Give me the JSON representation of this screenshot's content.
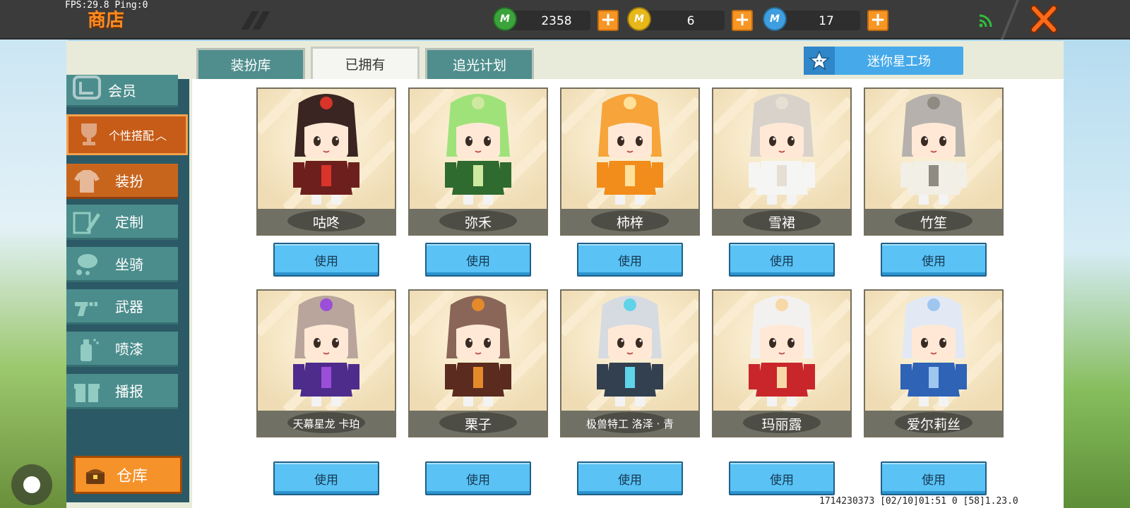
{
  "status_bar": {
    "fps_text": "FPS:29.8  Ping:0"
  },
  "header": {
    "title": "商店",
    "currencies": [
      {
        "icon": "green-gem-icon",
        "value": "2358",
        "color": "#3aa33a"
      },
      {
        "icon": "gold-coin-icon",
        "value": "6",
        "color": "#e8b71a"
      },
      {
        "icon": "mini-bean-icon",
        "value": "17",
        "color": "#3e9ee0"
      }
    ],
    "plus_label": "+",
    "coin_letter": "M"
  },
  "tabs": [
    {
      "label": "装扮库",
      "active": false
    },
    {
      "label": "已拥有",
      "active": true
    },
    {
      "label": "追光计划",
      "active": false
    }
  ],
  "workshop_button": {
    "label": "迷你星工场"
  },
  "sidebar": {
    "member": "会员",
    "header": "个性搭配",
    "items": [
      {
        "label": "装扮",
        "icon": "shirt-icon",
        "active": true
      },
      {
        "label": "定制",
        "icon": "pencil-icon",
        "active": false
      },
      {
        "label": "坐骑",
        "icon": "mount-icon",
        "active": false
      },
      {
        "label": "武器",
        "icon": "gun-icon",
        "active": false
      },
      {
        "label": "喷漆",
        "icon": "spray-can-icon",
        "active": false
      },
      {
        "label": "播报",
        "icon": "gift-box-icon",
        "active": false
      }
    ],
    "warehouse": "仓库"
  },
  "skins": [
    {
      "name": "咕咚",
      "button": "使用",
      "hair": "#3a2522",
      "outfit": "#6d1f1d",
      "accent": "#d8342a"
    },
    {
      "name": "弥禾",
      "button": "使用",
      "hair": "#9fe27a",
      "outfit": "#2f6a2f",
      "accent": "#cfe8a0"
    },
    {
      "name": "柿梓",
      "button": "使用",
      "hair": "#f7a43a",
      "outfit": "#f28c1b",
      "accent": "#ffe19a"
    },
    {
      "name": "雪裙",
      "button": "使用",
      "hair": "#d8d2cb",
      "outfit": "#f5f5f3",
      "accent": "#e6dfd4"
    },
    {
      "name": "竹笙",
      "button": "使用",
      "hair": "#b6b1ac",
      "outfit": "#f2efe6",
      "accent": "#8f8a82"
    },
    {
      "name": "天幕星龙 卡珀",
      "button": "使用",
      "hair": "#b9a59c",
      "outfit": "#4e2c8c",
      "accent": "#9b4ed8"
    },
    {
      "name": "栗子",
      "button": "使用",
      "hair": "#8a6658",
      "outfit": "#5a2b1e",
      "accent": "#e58a2a"
    },
    {
      "name": "极兽特工 洛泽 · 青",
      "button": "使用",
      "hair": "#d6dbe2",
      "outfit": "#33404f",
      "accent": "#5fd3e8"
    },
    {
      "name": "玛丽露",
      "button": "使用",
      "hair": "#f3f1ef",
      "outfit": "#c9262b",
      "accent": "#f7d9a8"
    },
    {
      "name": "爱尔莉丝",
      "button": "使用",
      "hair": "#e2e9f4",
      "outfit": "#2e63b6",
      "accent": "#9fc6ef"
    }
  ],
  "footer": {
    "info": "1714230373   [02/10]01:51 0   [58]1.23.0"
  }
}
